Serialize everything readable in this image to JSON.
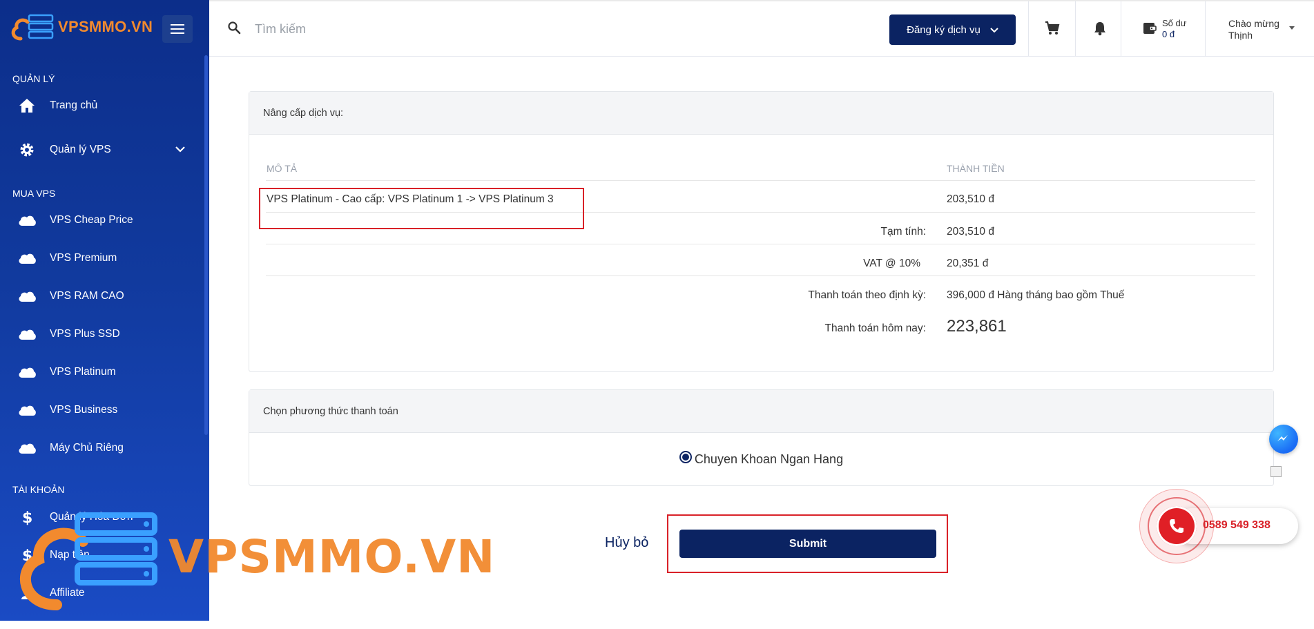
{
  "brand": {
    "logo_text": "VPSMMO.VN"
  },
  "sidebar": {
    "sections": [
      {
        "title": "QUẢN LÝ"
      },
      {
        "title": "MUA VPS"
      },
      {
        "title": "TÀI KHOẢN"
      }
    ],
    "items": [
      {
        "label": "Trang chủ",
        "icon": "home-icon"
      },
      {
        "label": "Quản lý VPS",
        "icon": "gear-icon"
      },
      {
        "label": "VPS Cheap Price",
        "icon": "cloud-icon"
      },
      {
        "label": "VPS Premium",
        "icon": "cloud-icon"
      },
      {
        "label": "VPS RAM CAO",
        "icon": "cloud-icon"
      },
      {
        "label": "VPS Plus SSD",
        "icon": "cloud-icon"
      },
      {
        "label": "VPS Platinum",
        "icon": "cloud-icon"
      },
      {
        "label": "VPS Business",
        "icon": "cloud-icon"
      },
      {
        "label": "Máy Chủ Riêng",
        "icon": "cloud-icon"
      },
      {
        "label": "Quản lý Hóa Đơn",
        "icon": "dollar-icon"
      },
      {
        "label": "Nạp tiền",
        "icon": "dollar-icon"
      },
      {
        "label": "Affiliate",
        "icon": "user-icon"
      }
    ]
  },
  "topbar": {
    "search_placeholder": "Tìm kiếm",
    "register_label": "Đăng ký dịch vụ",
    "balance_label": "Số dư",
    "balance_value": "0 đ",
    "greeting": "Chào mừng",
    "username": "Thịnh"
  },
  "upgrade": {
    "header": "Nâng cấp dịch vụ:",
    "col_desc": "MÔ TẢ",
    "col_amount": "THÀNH TIỀN",
    "item_desc": "VPS Platinum - Cao cấp: VPS Platinum 1 -> VPS Platinum 3",
    "item_amount": "203,510 đ",
    "subtotal_label": "Tạm tính:",
    "subtotal_value": "203,510 đ",
    "vat_label": "VAT @ 10%",
    "vat_value": "20,351 đ",
    "recurring_label": "Thanh toán theo định kỳ:",
    "recurring_value": "396,000 đ Hàng tháng bao gồm Thuế",
    "today_label": "Thanh toán hôm nay:",
    "today_value": "223,861"
  },
  "payment": {
    "header": "Chọn phương thức thanh toán",
    "method": "Chuyen Khoan Ngan Hang"
  },
  "actions": {
    "cancel_label": "Hủy bỏ",
    "submit_label": "Submit"
  },
  "contact": {
    "phone": "0589 549 338"
  },
  "watermark": {
    "text": "VPSMMO.VN"
  },
  "colors": {
    "navy": "#0b2362",
    "sidebar_top": "#0c2e8a",
    "sidebar_bottom": "#1a4bc4",
    "brand_orange": "#f28a2e",
    "highlight_red": "#d92128"
  }
}
